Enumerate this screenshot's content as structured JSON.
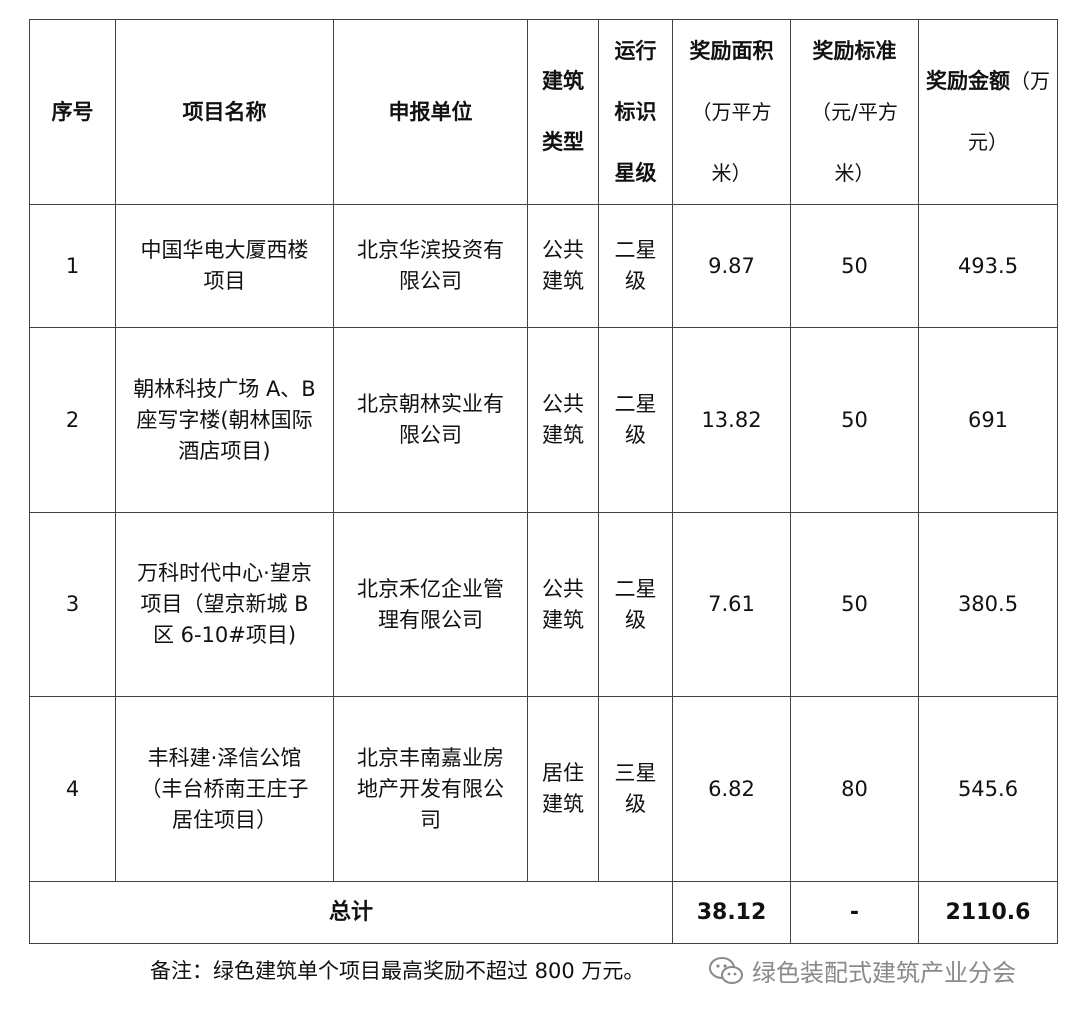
{
  "header": {
    "index": "序号",
    "project": "项目名称",
    "unit": "申报单位",
    "building_type_line1": "建筑",
    "building_type_line2": "类型",
    "rating_line1": "运行",
    "rating_line2": "标识",
    "rating_line3": "星级",
    "area_title": "奖励面积",
    "area_unit_line1": "（万平方",
    "area_unit_line2": "米）",
    "standard_title": "奖励标准",
    "standard_unit_line1": "（元/平方",
    "standard_unit_line2": "米）",
    "amount_title": "奖励金额",
    "amount_unit_line1": "（万",
    "amount_unit_line2": "元）"
  },
  "rows": [
    {
      "index": "1",
      "project_lines": [
        "中国华电大厦西楼",
        "项目"
      ],
      "unit_lines": [
        "北京华滨投资有",
        "限公司"
      ],
      "type_lines": [
        "公共",
        "建筑"
      ],
      "rating_lines": [
        "二星",
        "级"
      ],
      "area": "9.87",
      "standard": "50",
      "amount": "493.5"
    },
    {
      "index": "2",
      "project_lines": [
        "朝林科技广场 A、B",
        "座写字楼(朝林国际",
        "酒店项目)"
      ],
      "unit_lines": [
        "北京朝林实业有",
        "限公司"
      ],
      "type_lines": [
        "公共",
        "建筑"
      ],
      "rating_lines": [
        "二星",
        "级"
      ],
      "area": "13.82",
      "standard": "50",
      "amount": "691"
    },
    {
      "index": "3",
      "project_lines": [
        "万科时代中心·望京",
        "项目（望京新城 B",
        "区 6-10#项目)"
      ],
      "unit_lines": [
        "北京禾亿企业管",
        "理有限公司"
      ],
      "type_lines": [
        "公共",
        "建筑"
      ],
      "rating_lines": [
        "二星",
        "级"
      ],
      "area": "7.61",
      "standard": "50",
      "amount": "380.5"
    },
    {
      "index": "4",
      "project_lines": [
        "丰科建·泽信公馆",
        "（丰台桥南王庄子",
        "居住项目）"
      ],
      "unit_lines": [
        "北京丰南嘉业房",
        "地产开发有限公",
        "司"
      ],
      "type_lines": [
        "居住",
        "建筑"
      ],
      "rating_lines": [
        "三星",
        "级"
      ],
      "area": "6.82",
      "standard": "80",
      "amount": "545.6"
    }
  ],
  "total": {
    "label": "总计",
    "area": "38.12",
    "standard": "-",
    "amount": "2110.6"
  },
  "note": "备注：绿色建筑单个项目最高奖励不超过 800 万元。",
  "watermark": {
    "text": "绿色装配式建筑产业分会",
    "icon": "wechat-icon"
  }
}
